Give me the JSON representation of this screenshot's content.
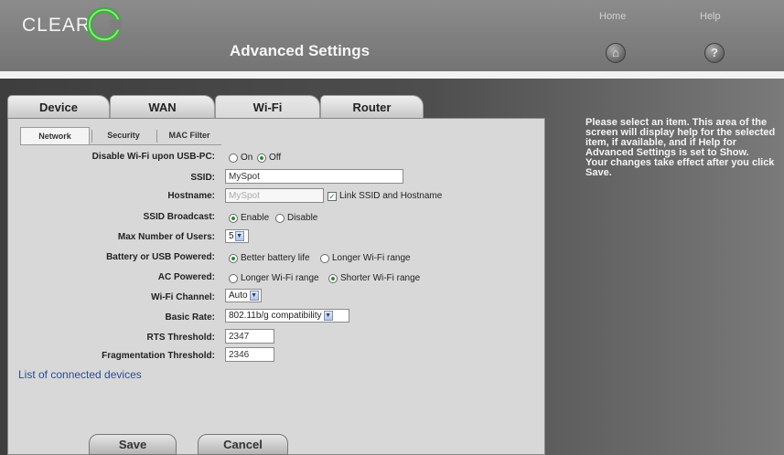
{
  "header": {
    "brand": "CLEAR",
    "title": "Advanced Settings",
    "home_label": "Home",
    "help_label": "Help",
    "home_icon": "home-icon",
    "help_icon": "question-icon"
  },
  "tabs": [
    "Device",
    "WAN",
    "Wi-Fi",
    "Router"
  ],
  "active_tab": "Wi-Fi",
  "subtabs": [
    "Network",
    "Security",
    "MAC Filter"
  ],
  "active_subtab": "Network",
  "form": {
    "disable_wifi": {
      "label": "Disable Wi-Fi upon USB-PC:",
      "opt_on": "On",
      "opt_off": "Off",
      "selected": "Off"
    },
    "ssid": {
      "label": "SSID:",
      "value": "MySpot"
    },
    "hostname": {
      "label": "Hostname:",
      "value": "MySpot",
      "link_label": "Link SSID and Hostname",
      "linked": true
    },
    "ssid_broadcast": {
      "label": "SSID Broadcast:",
      "opt_enable": "Enable",
      "opt_disable": "Disable",
      "selected": "Enable"
    },
    "max_users": {
      "label": "Max Number of Users:",
      "value": "5"
    },
    "battery_usb": {
      "label": "Battery or USB Powered:",
      "opt_a": "Better battery life",
      "opt_b": "Longer Wi-Fi range",
      "selected": "Better battery life"
    },
    "ac_powered": {
      "label": "AC Powered:",
      "opt_a": "Longer Wi-Fi range",
      "opt_b": "Shorter Wi-Fi range",
      "selected": "Shorter Wi-Fi range"
    },
    "wifi_channel": {
      "label": "Wi-Fi Channel:",
      "value": "Auto"
    },
    "basic_rate": {
      "label": "Basic Rate:",
      "value": "802.11b/g compatibility"
    },
    "rts_threshold": {
      "label": "RTS Threshold:",
      "value": "2347"
    },
    "frag_threshold": {
      "label": "Fragmentation Threshold:",
      "value": "2346"
    }
  },
  "connected_devices_link": "List of connected devices",
  "buttons": {
    "save": "Save",
    "cancel": "Cancel"
  },
  "help_text": {
    "line1": "Please select an item. This area of the screen will display help for the selected item, if available, and if Help for Advanced Settings is set to Show.",
    "line2": "Your changes take effect after you click Save."
  },
  "colors": {
    "accent_green": "#2d8a2d",
    "link_blue": "#2a4c95"
  }
}
